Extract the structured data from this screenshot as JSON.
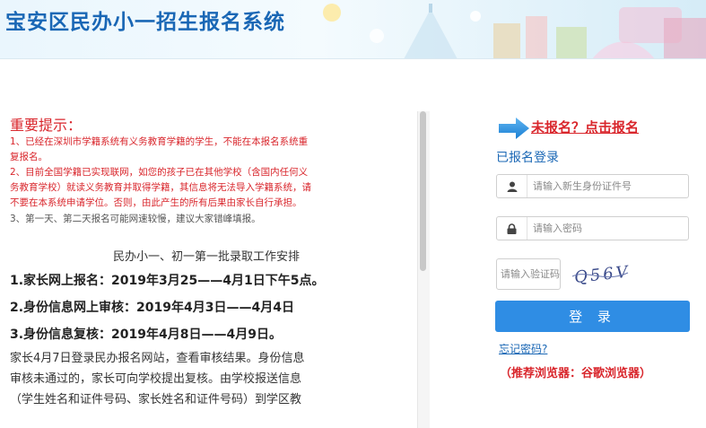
{
  "header": {
    "title": "宝安区民办小一招生报名系统"
  },
  "notice": {
    "title": "重要提示：",
    "item1_line1": "1、已经在深圳市学籍系统有义务教育学籍的学生，不能在本报名系统重",
    "item1_line2": "复报名。",
    "item2_line1": "2、目前全国学籍已实现联网，如您的孩子已在其他学校（含国内任何义",
    "item2_line2": "务教育学校）就读义务教育并取得学籍，其信息将无法导入学籍系统，请",
    "item2_line3": "不要在本系统申请学位。否则，由此产生的所有后果由家长自行承担。",
    "item3": "3、第一天、第二天报名可能网速较慢，建议大家错峰填报。"
  },
  "arrangement": {
    "title": "民办小一、初一第一批录取工作安排",
    "step1": "1.家长网上报名：2019年3月25——4月1日下午5点。",
    "step2": "2.身份信息网上审核：2019年4月3日——4月4日",
    "step3": "3.身份信息复核：2019年4月8日——4月9日。",
    "para_line1": "家长4月7日登录民办报名网站，查看审核结果。身份信息",
    "para_line2": "审核未通过的，家长可向学校提出复核。由学校报送信息",
    "para_line3": "（学生姓名和证件号码、家长姓名和证件号码）到学区教"
  },
  "login": {
    "register_link": "未报名？点击报名",
    "logged_label": "已报名登录",
    "id_placeholder": "请输入新生身份证件号",
    "password_placeholder": "请输入密码",
    "captcha_placeholder": "请输入验证码",
    "captcha_text": "Q56V",
    "login_button": "登 录",
    "forgot_link": "忘记密码?",
    "browser_tip": "（推荐浏览器：谷歌浏览器）"
  },
  "colors": {
    "brand_blue": "#1a67b5",
    "button_blue": "#2f8de4",
    "alert_red": "#d9262c"
  },
  "icons": {
    "arrow": "arrow-right-icon",
    "user": "user-icon",
    "lock": "lock-icon"
  }
}
